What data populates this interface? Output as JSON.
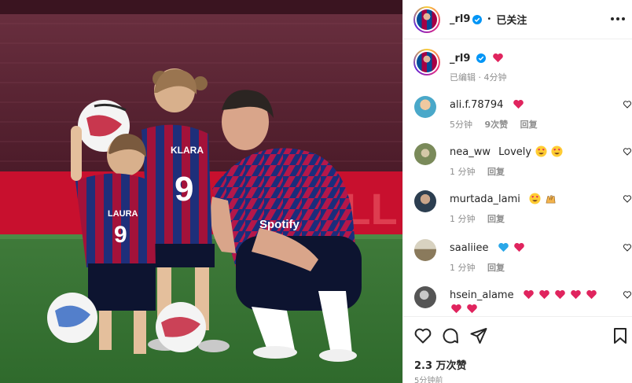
{
  "post": {
    "username": "_rl9",
    "follow_status": "已关注",
    "caption_edited": "已编辑",
    "caption_time": "4分钟",
    "like_count_label": "2.3 万次赞",
    "posted_ago": "5分钟前"
  },
  "photo": {
    "alt": "Player crouching with two young daughters on a football pitch",
    "jersey_names": [
      "KLARA",
      "LAURA"
    ],
    "jersey_numbers": [
      "9",
      "9"
    ],
    "sponsor": "Spotify"
  },
  "comments": [
    {
      "user": "ali.f.78794",
      "text": "",
      "emoji": [
        "red-heart"
      ],
      "time": "5分钟",
      "likes": "9次赞",
      "reply": "回复",
      "avatar_color": "#4aa8c9"
    },
    {
      "user": "nea_ww",
      "text": "Lovely",
      "emoji": [
        "heart-eyes",
        "heart-eyes"
      ],
      "time": "1 分钟",
      "likes": "",
      "reply": "回复",
      "avatar_color": "#7a8a5a"
    },
    {
      "user": "murtada_lami",
      "text": "",
      "emoji": [
        "heart-eyes",
        "raised-hands"
      ],
      "time": "1 分钟",
      "likes": "",
      "reply": "回复",
      "avatar_color": "#2c3e50"
    },
    {
      "user": "saaliiee",
      "text": "",
      "emoji": [
        "blue-heart",
        "red-heart"
      ],
      "time": "1 分钟",
      "likes": "",
      "reply": "回复",
      "avatar_color": "#a89a7c"
    },
    {
      "user": "hsein_alame",
      "text": "",
      "emoji": [
        "red-heart",
        "red-heart",
        "red-heart",
        "red-heart",
        "red-heart",
        "red-heart",
        "red-heart"
      ],
      "time": "",
      "likes": "",
      "reply": "",
      "avatar_color": "#555555"
    }
  ],
  "colors": {
    "verified": "#0095f6",
    "heart": "#ed4956",
    "muted_text": "#8e8e8e",
    "barca_blue": "#004d98",
    "barca_red": "#a50044"
  },
  "icons": {
    "more": "more-horizontal-icon",
    "like": "heart-outline-icon",
    "comment": "comment-icon",
    "share": "send-icon",
    "save": "bookmark-icon"
  }
}
